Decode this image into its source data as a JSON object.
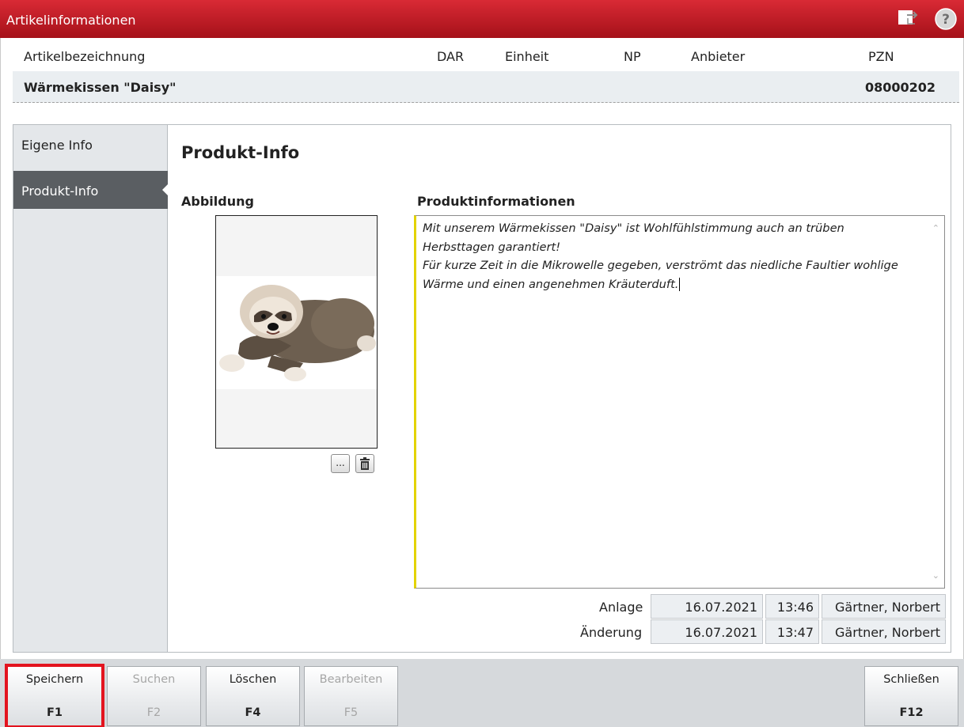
{
  "window": {
    "title": "Artikelinformationen"
  },
  "header": {
    "columns": {
      "artikel": "Artikelbezeichnung",
      "dar": "DAR",
      "einheit": "Einheit",
      "np": "NP",
      "anbieter": "Anbieter",
      "pzn": "PZN"
    },
    "values": {
      "artikel": "Wärmekissen \"Daisy\"",
      "pzn": "08000202"
    }
  },
  "sidebar": {
    "items": [
      {
        "label": "Eigene Info",
        "selected": false
      },
      {
        "label": "Produkt-Info",
        "selected": true
      }
    ]
  },
  "panel": {
    "title": "Produkt-Info",
    "image_label": "Abbildung",
    "image_buttons": {
      "browse": "...",
      "delete_icon": "trash-icon"
    },
    "info_label": "Produktinformationen",
    "info_lines": [
      "Mit unserem Wärmekissen \"Daisy\" ist Wohlfühlstimmung auch an trüben",
      "Herbsttagen garantiert!",
      "Für kurze Zeit in die Mikrowelle gegeben, verströmt das niedliche Faultier wohlige",
      "Wärme und einen angenehmen Kräuterduft."
    ],
    "anlage": {
      "label": "Anlage",
      "date": "16.07.2021",
      "time": "13:46",
      "user": "Gärtner, Norbert"
    },
    "aenderung": {
      "label": "Änderung",
      "date": "16.07.2021",
      "time": "13:47",
      "user": "Gärtner, Norbert"
    }
  },
  "footer": {
    "buttons": [
      {
        "label": "Speichern",
        "key": "F1",
        "enabled": true,
        "highlighted": true
      },
      {
        "label": "Suchen",
        "key": "F2",
        "enabled": false
      },
      {
        "label": "Löschen",
        "key": "F4",
        "enabled": true
      },
      {
        "label": "Bearbeiten",
        "key": "F5",
        "enabled": false
      },
      {
        "label": "Schließen",
        "key": "F12",
        "enabled": true
      }
    ]
  },
  "colors": {
    "titlebar": "#c41d27",
    "accent_yellow": "#e3d300",
    "highlight": "#e3141f",
    "nav_selected": "#5a5e62"
  }
}
